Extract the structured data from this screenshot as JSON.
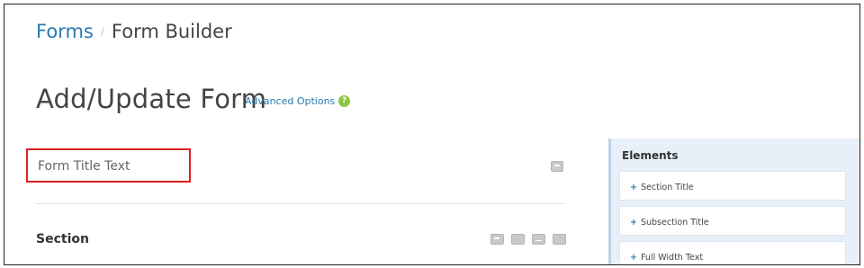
{
  "breadcrumb": {
    "link_label": "Forms",
    "separator": "/",
    "current_label": "Form Builder"
  },
  "page": {
    "title": "Add/Update Form",
    "advanced_options_label": "Advanced Options",
    "help_icon_glyph": "?"
  },
  "form": {
    "title_placeholder": "Form Title Text",
    "title_value": "",
    "section_label": "Section"
  },
  "elements_panel": {
    "header": "Elements",
    "add_glyph": "+",
    "items": [
      {
        "label": "Section Title"
      },
      {
        "label": "Subsection Title"
      },
      {
        "label": "Full Width Text"
      }
    ]
  },
  "colors": {
    "link": "#2a7ab0",
    "help_badge": "#8cc63f",
    "highlight_border": "#e02020",
    "panel_background": "#e7f0f8"
  },
  "icons": {
    "title_comment": "comment-icon",
    "section_tools": [
      "comment-icon",
      "copy-icon",
      "minimize-icon",
      "delete-icon"
    ]
  }
}
